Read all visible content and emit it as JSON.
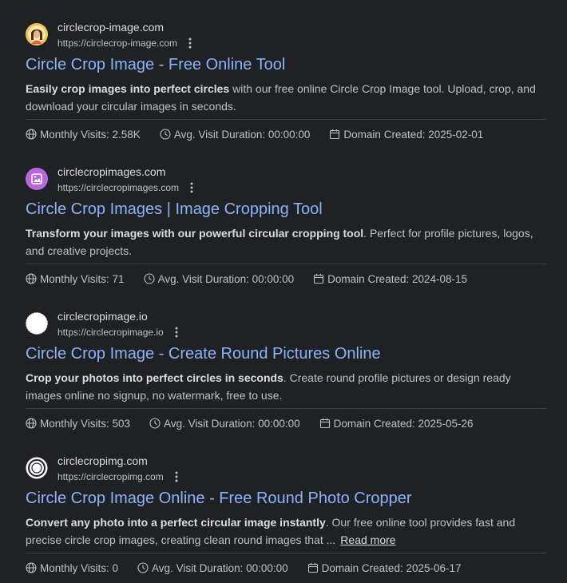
{
  "results": [
    {
      "site_name": "circlecrop-image.com",
      "site_url": "https://circlecrop-image.com",
      "favicon": "woman-avatar-icon",
      "title": "Circle Crop Image - Free Online Tool",
      "snippet_bold": "Easily crop images into perfect circles",
      "snippet_rest": " with our free online Circle Crop Image tool. Upload, crop, and download your circular images in seconds.",
      "read_more": "",
      "stats": {
        "visits_label": "Monthly Visits: 2.58K",
        "duration_label": "Avg. Visit Duration: 00:00:00",
        "created_label": "Domain Created: 2025-02-01"
      }
    },
    {
      "site_name": "circlecropimages.com",
      "site_url": "https://circlecropimages.com",
      "favicon": "purple-crop-icon",
      "title": "Circle Crop Images | Image Cropping Tool",
      "snippet_bold": "Transform your images with our powerful circular cropping tool",
      "snippet_rest": ". Perfect for profile pictures, logos, and creative projects.",
      "read_more": "",
      "stats": {
        "visits_label": "Monthly Visits: 71",
        "duration_label": "Avg. Visit Duration: 00:00:00",
        "created_label": "Domain Created: 2024-08-15"
      }
    },
    {
      "site_name": "circlecropimage.io",
      "site_url": "https://circlecropimage.io",
      "favicon": "white-circle-icon",
      "title": "Circle Crop Image - Create Round Pictures Online",
      "snippet_bold": "Crop your photos into perfect circles in seconds",
      "snippet_rest": ". Create round profile pictures or design ready images online no signup, no watermark, free to use.",
      "read_more": "",
      "stats": {
        "visits_label": "Monthly Visits: 503",
        "duration_label": "Avg. Visit Duration: 00:00:00",
        "created_label": "Domain Created: 2025-05-26"
      }
    },
    {
      "site_name": "circlecropimg.com",
      "site_url": "https://circlecropimg.com",
      "favicon": "circle-logo-icon",
      "title": "Circle Crop Image Online - Free Round Photo Cropper",
      "snippet_bold": "Convert any photo into a perfect circular image instantly",
      "snippet_rest": ". Our free online tool provides fast and precise circle crop images, creating clean round images that ...",
      "read_more": "Read more",
      "stats": {
        "visits_label": "Monthly Visits: 0",
        "duration_label": "Avg. Visit Duration: 00:00:00",
        "created_label": "Domain Created: 2025-06-17"
      }
    }
  ],
  "icons": {
    "more": "three-dots-vertical-icon",
    "visits": "globe-icon",
    "duration": "clock-icon",
    "created": "calendar-icon"
  }
}
